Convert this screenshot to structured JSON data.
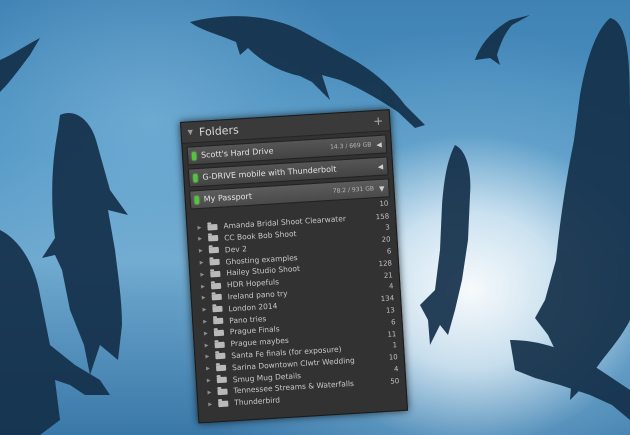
{
  "panel": {
    "title": "Folders",
    "add_icon": "plus-icon",
    "volumes": [
      {
        "name": "Scott's Hard Drive",
        "size": "14.3 / 669 GB",
        "status_color": "#57c23b"
      },
      {
        "name": "G-DRIVE mobile with Thunderbolt",
        "size": "",
        "status_color": "#57c23b"
      },
      {
        "name": "My Passport",
        "size": "78.2 / 931 GB",
        "count": "10",
        "status_color": "#57c23b"
      }
    ],
    "folders": [
      {
        "name": "Amanda Bridal Shoot Clearwater",
        "count": "158"
      },
      {
        "name": "CC Book Bob Shoot",
        "count": "3"
      },
      {
        "name": "Dev 2",
        "count": "20"
      },
      {
        "name": "Ghosting examples",
        "count": "6"
      },
      {
        "name": "Hailey Studio Shoot",
        "count": "128"
      },
      {
        "name": "HDR Hopefuls",
        "count": "21"
      },
      {
        "name": "Ireland pano try",
        "count": "4"
      },
      {
        "name": "London 2014",
        "count": "134"
      },
      {
        "name": "Pano tries",
        "count": "13"
      },
      {
        "name": "Prague Finals",
        "count": "6"
      },
      {
        "name": "Prague maybes",
        "count": "11"
      },
      {
        "name": "Santa Fe finals (for exposure)",
        "count": "1"
      },
      {
        "name": "Sarina Downtown Clwtr Wedding",
        "count": "10"
      },
      {
        "name": "Smug Mug Details",
        "count": "4"
      },
      {
        "name": "Tennessee Streams & Waterfalls",
        "count": "50"
      },
      {
        "name": "Thunderbird",
        "count": ""
      }
    ]
  }
}
